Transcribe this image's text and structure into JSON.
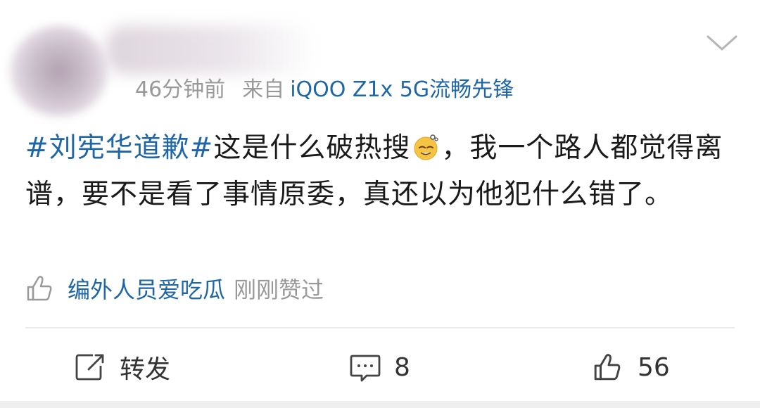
{
  "post": {
    "time": "46分钟前",
    "source_prefix": "来自",
    "device": "iQOO Z1x 5G流畅先锋",
    "content": {
      "hashtag": "#刘宪华道歉#",
      "text_before_emoji": "这是什么破热搜",
      "emoji": "dizzy-smile-emoji",
      "text_after_emoji": "，我一个路人都觉得离谱，要不是看了事情原委，真还以为他犯什么错了。"
    },
    "liked_by": {
      "user": "编外人员爱吃瓜",
      "status": "刚刚赞过"
    }
  },
  "actions": {
    "repost_label": "转发",
    "comment_count": "8",
    "like_count": "56"
  },
  "icons": {
    "menu": "chevron-down-icon",
    "like_outline": "thumb-up-icon",
    "repost": "share-box-icon",
    "comment": "comment-icon"
  },
  "colors": {
    "link": "#1f66a6",
    "meta": "#999999",
    "text": "#1a1a1a"
  }
}
